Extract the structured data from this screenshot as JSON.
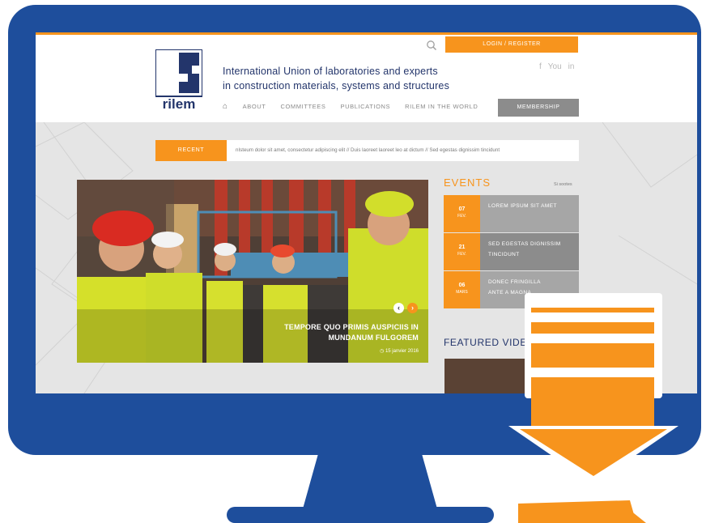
{
  "site": {
    "logo_text": "rilem",
    "org_name_line1": "International Union of laboratories and experts",
    "org_name_line2": "in construction materials, systems and structures",
    "login": "LOGIN / REGISTER",
    "social": [
      "f",
      "You",
      "in"
    ],
    "nav": [
      "ABOUT",
      "COMMITTEES",
      "PUBLICATIONS",
      "RILEM IN THE WORLD"
    ],
    "membership": "MEMBERSHIP"
  },
  "recent": {
    "label": "RECENT",
    "text": "nIsteum dolor sit amet, consectetur adipiscing elit  //  Duis laoreet laoreet leo at dictum  //  Sed egestas dignissim tincidunt"
  },
  "hero": {
    "caption_line1": "TEMPORE QUO PRIMIS AUSPICIIS IN",
    "caption_line2": "MUNDANUM FULGOREM",
    "date": "15 janvier 2016"
  },
  "events": {
    "title": "EVENTS",
    "see_all": "Si sootes",
    "items": [
      {
        "day": "07",
        "month": "FEV.",
        "title_line1": "LOREM IPSUM SIT AMET",
        "title_line2": ""
      },
      {
        "day": "21",
        "month": "FEV.",
        "title_line1": "SED EGESTAS DIGNISSIM",
        "title_line2": "TINCIDUNT"
      },
      {
        "day": "06",
        "month": "MARS",
        "title_line1": "DONEC FRINGILLA",
        "title_line2": "ANTE A MAGNA"
      }
    ]
  },
  "featured": {
    "title": "FEATURED VIDE"
  },
  "colors": {
    "accent": "#f7941d",
    "monitor": "#1e4e9c",
    "navy_text": "#23356b"
  }
}
